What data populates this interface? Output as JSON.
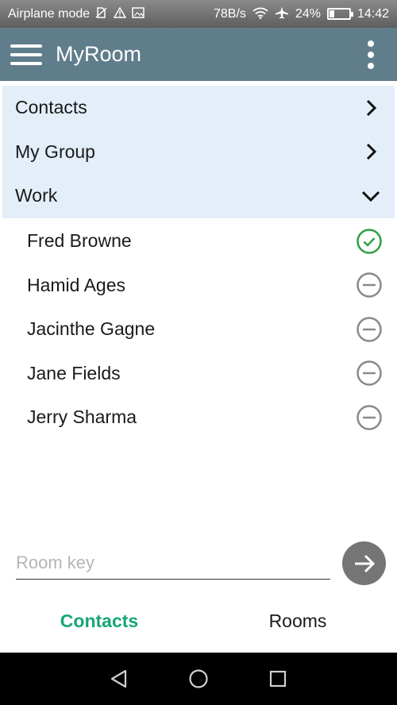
{
  "status_bar": {
    "left_text": "Airplane mode",
    "speed": "78B/s",
    "battery": "24%",
    "battery_level": 0.24,
    "time": "14:42",
    "icons": [
      "sim-icon",
      "warning-icon",
      "image-icon",
      "wifi-icon",
      "airplane-icon",
      "battery-icon"
    ]
  },
  "app_bar": {
    "title": "MyRoom",
    "icons": [
      "menu-icon",
      "more-vert-icon"
    ]
  },
  "groups": [
    {
      "label": "Contacts",
      "state": "collapsed",
      "icon": "chevron-right-icon"
    },
    {
      "label": "My Group",
      "state": "collapsed",
      "icon": "chevron-right-icon"
    },
    {
      "label": "Work",
      "state": "expanded",
      "icon": "chevron-down-icon"
    }
  ],
  "members": [
    {
      "name": "Fred Browne",
      "status": "online",
      "icon": "check-circle-icon",
      "color": "#2ea043"
    },
    {
      "name": "Hamid Ages",
      "status": "offline",
      "icon": "minus-circle-icon",
      "color": "#8a8a8a"
    },
    {
      "name": "Jacinthe Gagne",
      "status": "offline",
      "icon": "minus-circle-icon",
      "color": "#8a8a8a"
    },
    {
      "name": "Jane Fields",
      "status": "offline",
      "icon": "minus-circle-icon",
      "color": "#8a8a8a"
    },
    {
      "name": "Jerry Sharma",
      "status": "offline",
      "icon": "minus-circle-icon",
      "color": "#8a8a8a"
    }
  ],
  "room_key": {
    "placeholder": "Room key",
    "value": "",
    "submit_icon": "arrow-right-icon"
  },
  "bottom_tabs": [
    {
      "label": "Contacts",
      "active": true
    },
    {
      "label": "Rooms",
      "active": false
    }
  ],
  "nav_bar": {
    "icons": [
      "back-icon",
      "home-icon",
      "recents-icon"
    ]
  },
  "colors": {
    "app_bar": "#607d8b",
    "group_bg": "#e3eef9",
    "accent": "#17a673",
    "online": "#2ea043",
    "offline": "#8a8a8a"
  }
}
